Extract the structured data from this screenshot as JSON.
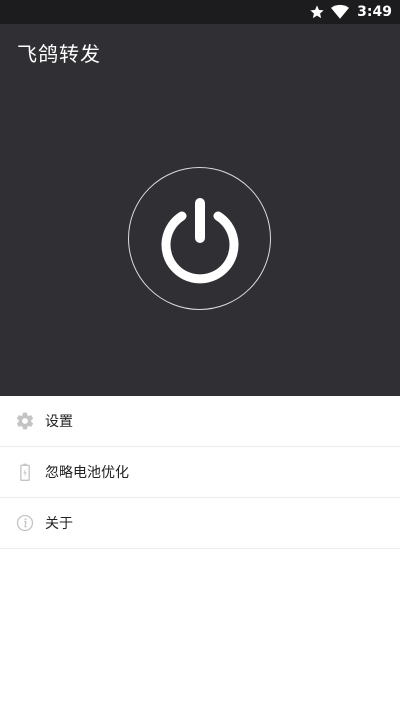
{
  "status_bar": {
    "time": "3:49",
    "icons": [
      "star-icon",
      "wifi-icon"
    ]
  },
  "app": {
    "title": "飞鸽转发"
  },
  "power_button": {
    "icon": "power-icon"
  },
  "menu": {
    "items": [
      {
        "label": "设置",
        "icon": "gear-icon"
      },
      {
        "label": "忽略电池优化",
        "icon": "battery-icon"
      },
      {
        "label": "关于",
        "icon": "info-icon"
      }
    ]
  },
  "colors": {
    "header_bg": "#302f33",
    "status_bg": "#1c1c1f",
    "icon_gray": "#c4c4c4"
  }
}
